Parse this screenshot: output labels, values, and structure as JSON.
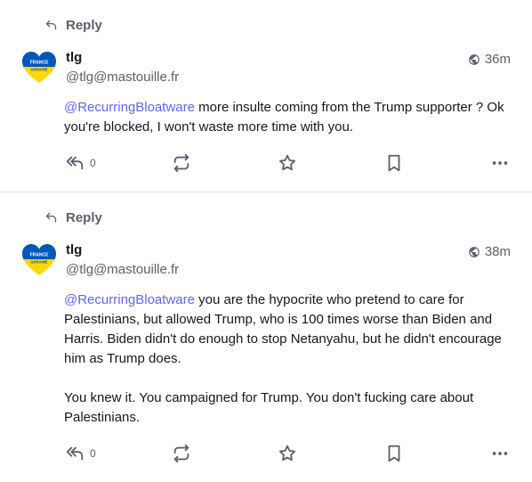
{
  "posts": [
    {
      "prepend_label": "Reply",
      "avatar_text_top": "FRANCE",
      "avatar_text_bottom": "UKRAINE",
      "display_name": "tlg",
      "account": "@tlg@mastouille.fr",
      "visibility_icon": "globe-icon",
      "time": "36m",
      "mention": "@RecurringBloatware",
      "paragraphs": [
        " more insulte coming from the Trump supporter ? Ok you're blocked, I won't waste more time with you."
      ],
      "reply_count": "0"
    },
    {
      "prepend_label": "Reply",
      "avatar_text_top": "FRANCE",
      "avatar_text_bottom": "UKRAINE",
      "display_name": "tlg",
      "account": "@tlg@mastouille.fr",
      "visibility_icon": "globe-icon",
      "time": "38m",
      "mention": "@RecurringBloatware",
      "paragraphs": [
        " you are the hypocrite who pretend to care for Palestinians, but allowed Trump, who is 100 times worse than Biden and Harris. Biden didn't do enough to stop Netanyahu, but he didn't encourage him as Trump does.",
        "You knew it. You campaigned for Trump. You don't fucking care about Palestinians."
      ],
      "reply_count": "0"
    }
  ],
  "colors": {
    "accent": "#6364ff",
    "heart_blue": "#0057b7",
    "heart_yellow": "#ffd700",
    "muted": "#5d5f6b"
  }
}
